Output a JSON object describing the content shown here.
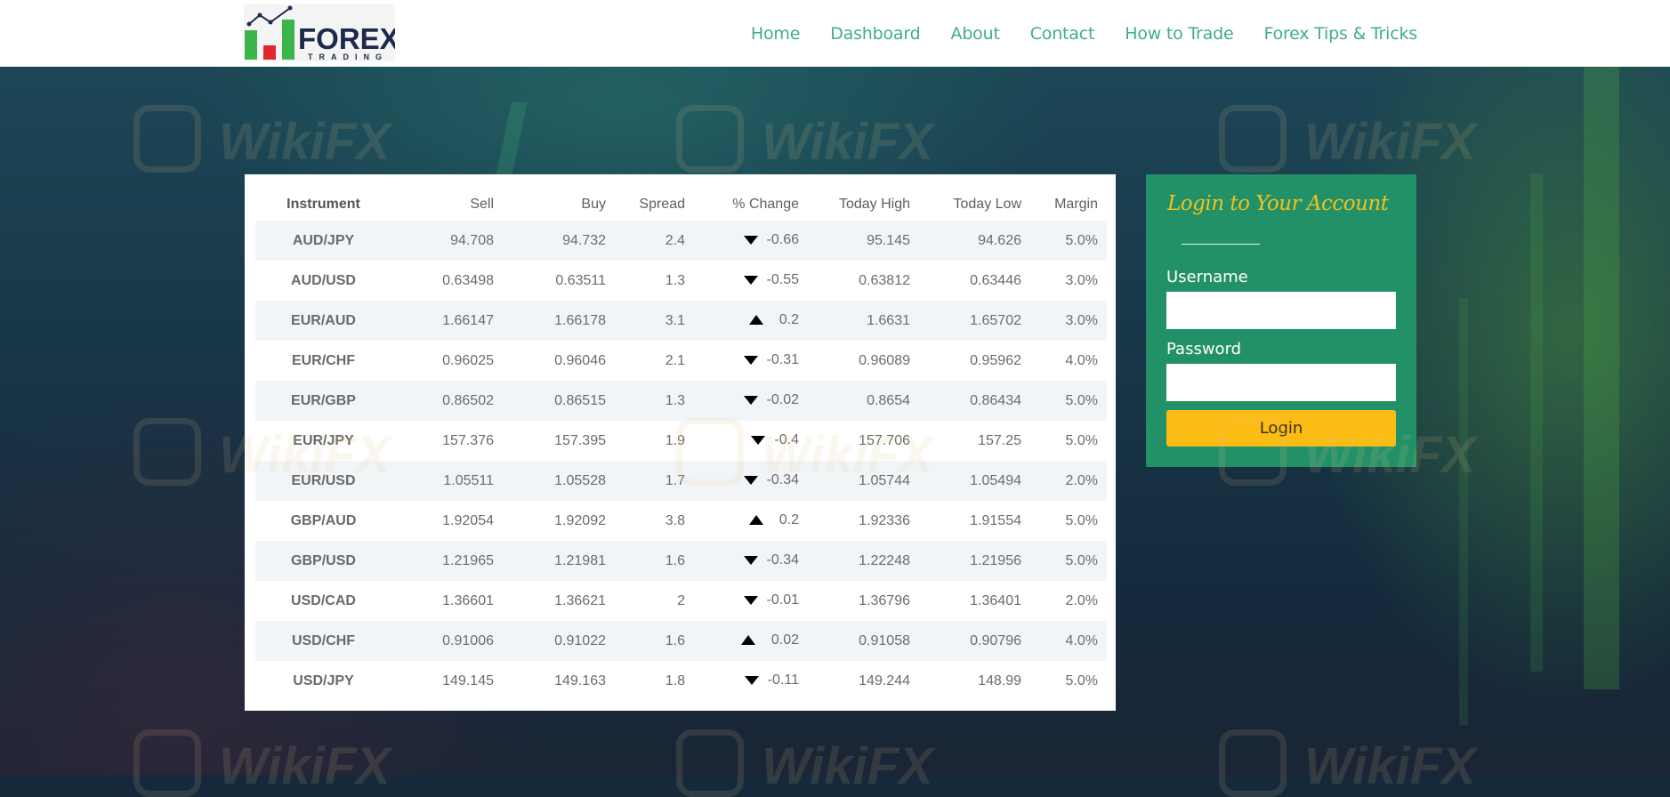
{
  "header": {
    "logo": {
      "icon": "forex-trading-logo",
      "wordmark": "FOREX",
      "tagline": "TRADING"
    },
    "nav": [
      "Home",
      "Dashboard",
      "About",
      "Contact",
      "How to Trade",
      "Forex Tips & Tricks"
    ]
  },
  "rates": {
    "columns": [
      "Instrument",
      "Sell",
      "Buy",
      "Spread",
      "% Change",
      "Today High",
      "Today Low",
      "Margin"
    ],
    "rows": [
      {
        "instrument": "AUD/JPY",
        "sell": "94.708",
        "buy": "94.732",
        "spread": "2.4",
        "direction": "down",
        "change": "-0.66",
        "high": "95.145",
        "low": "94.626",
        "margin": "5.0%"
      },
      {
        "instrument": "AUD/USD",
        "sell": "0.63498",
        "buy": "0.63511",
        "spread": "1.3",
        "direction": "down",
        "change": "-0.55",
        "high": "0.63812",
        "low": "0.63446",
        "margin": "3.0%"
      },
      {
        "instrument": "EUR/AUD",
        "sell": "1.66147",
        "buy": "1.66178",
        "spread": "3.1",
        "direction": "up",
        "change": "0.2",
        "high": "1.6631",
        "low": "1.65702",
        "margin": "3.0%"
      },
      {
        "instrument": "EUR/CHF",
        "sell": "0.96025",
        "buy": "0.96046",
        "spread": "2.1",
        "direction": "down",
        "change": "-0.31",
        "high": "0.96089",
        "low": "0.95962",
        "margin": "4.0%"
      },
      {
        "instrument": "EUR/GBP",
        "sell": "0.86502",
        "buy": "0.86515",
        "spread": "1.3",
        "direction": "down",
        "change": "-0.02",
        "high": "0.8654",
        "low": "0.86434",
        "margin": "5.0%"
      },
      {
        "instrument": "EUR/JPY",
        "sell": "157.376",
        "buy": "157.395",
        "spread": "1.9",
        "direction": "down",
        "change": "-0.4",
        "high": "157.706",
        "low": "157.25",
        "margin": "5.0%"
      },
      {
        "instrument": "EUR/USD",
        "sell": "1.05511",
        "buy": "1.05528",
        "spread": "1.7",
        "direction": "down",
        "change": "-0.34",
        "high": "1.05744",
        "low": "1.05494",
        "margin": "2.0%"
      },
      {
        "instrument": "GBP/AUD",
        "sell": "1.92054",
        "buy": "1.92092",
        "spread": "3.8",
        "direction": "up",
        "change": "0.2",
        "high": "1.92336",
        "low": "1.91554",
        "margin": "5.0%"
      },
      {
        "instrument": "GBP/USD",
        "sell": "1.21965",
        "buy": "1.21981",
        "spread": "1.6",
        "direction": "down",
        "change": "-0.34",
        "high": "1.22248",
        "low": "1.21956",
        "margin": "5.0%"
      },
      {
        "instrument": "USD/CAD",
        "sell": "1.36601",
        "buy": "1.36621",
        "spread": "2",
        "direction": "down",
        "change": "-0.01",
        "high": "1.36796",
        "low": "1.36401",
        "margin": "2.0%"
      },
      {
        "instrument": "USD/CHF",
        "sell": "0.91006",
        "buy": "0.91022",
        "spread": "1.6",
        "direction": "up",
        "change": "0.02",
        "high": "0.91058",
        "low": "0.90796",
        "margin": "4.0%"
      },
      {
        "instrument": "USD/JPY",
        "sell": "149.145",
        "buy": "149.163",
        "spread": "1.8",
        "direction": "down",
        "change": "-0.11",
        "high": "149.244",
        "low": "148.99",
        "margin": "5.0%"
      }
    ]
  },
  "login": {
    "title": "Login to Your Account",
    "username_label": "Username",
    "username_value": "",
    "password_label": "Password",
    "password_value": "",
    "button_label": "Login"
  },
  "watermark": {
    "text": "WikiFX",
    "icon": "wikifx-logo-icon"
  },
  "colors": {
    "nav_text": "#3fae8c",
    "login_panel": "#239167",
    "login_title": "#f4c21e",
    "login_button": "#fbbd14",
    "logo_green": "#3cb54a",
    "logo_red": "#e3262d",
    "logo_navy": "#1e2a4c"
  }
}
